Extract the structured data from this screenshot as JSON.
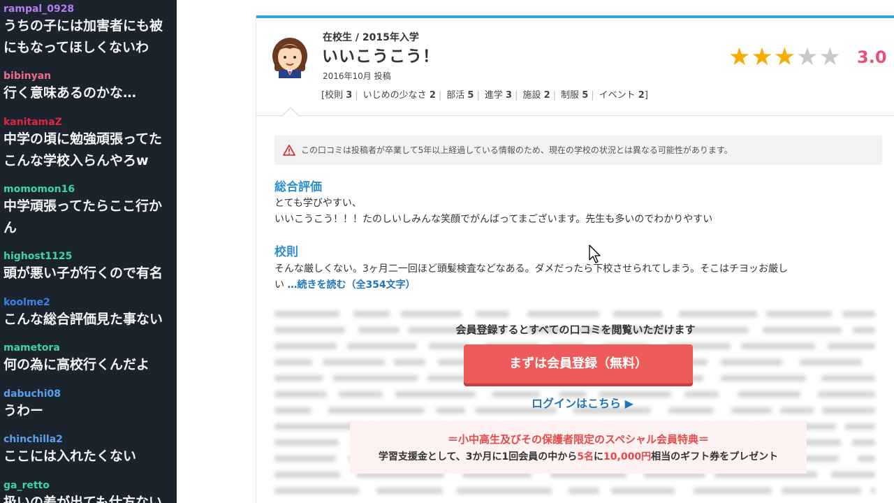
{
  "chat": {
    "messages": [
      {
        "user": "rampal_0928",
        "color": "#b77cf2",
        "lines": [
          "うちの子には加害者にも被",
          "にもなってほしくないわ"
        ]
      },
      {
        "user": "bibinyan",
        "color": "#f06a8f",
        "lines": [
          "行く意味あるのかな…"
        ]
      },
      {
        "user": "kanitamaZ",
        "color": "#e2234a",
        "lines": [
          "中学の頃に勉強頑張ってた",
          "こんな学校入らんやろw"
        ]
      },
      {
        "user": "momomon16",
        "color": "#3bd6a6",
        "lines": [
          "中学頑張ってたらここ行か",
          "ん"
        ]
      },
      {
        "user": "highost1125",
        "color": "#3bd6a6",
        "lines": [
          "頭が悪い子が行くので有名"
        ]
      },
      {
        "user": "koolme2",
        "color": "#3b82e8",
        "lines": [
          "こんな総合評価見た事ない"
        ]
      },
      {
        "user": "mametora",
        "color": "#3bd6a6",
        "lines": [
          "何の為に高校行くんだよ"
        ]
      },
      {
        "user": "dabuchi08",
        "color": "#5aa0ea",
        "lines": [
          "うわー"
        ]
      },
      {
        "user": "chinchilla2",
        "color": "#5aa0ea",
        "lines": [
          "ここには入れたくない"
        ]
      },
      {
        "user": "ga_retto",
        "color": "#3bd6a6",
        "lines": [
          "扱いの差が出ても仕方ない"
        ]
      }
    ]
  },
  "review": {
    "role": "在校生 / 2015年入学",
    "title": "いいこうこう！",
    "posted": "2016年10月 投稿",
    "cats_open": "[",
    "cats_close": "]",
    "categories": [
      {
        "label": "校則",
        "score": "3"
      },
      {
        "label": "いじめの少なさ",
        "score": "2"
      },
      {
        "label": "部活",
        "score": "5"
      },
      {
        "label": "進学",
        "score": "3"
      },
      {
        "label": "施設",
        "score": "2"
      },
      {
        "label": "制服",
        "score": "5"
      },
      {
        "label": "イベント",
        "score": "2"
      }
    ],
    "rating": 3,
    "rating_max": 5,
    "score": "3.0",
    "warning": "この口コミは投稿者が卒業して5年以上経過している情報のため、現在の学校の状況とは異なる可能性があります。",
    "sections": [
      {
        "heading": "総合評価",
        "lines": [
          "とても学びやすい、",
          "いいこうこう！！！たのしいしみんな笑顔でがんばってまございます。先生も多いのでわかりやすい"
        ]
      },
      {
        "heading": "校則",
        "lines": [
          "そんな厳しくない。3ヶ月二一回ほど頭髪検査などなある。ダメだったら下校させられてしまう。そこはチヨッお厳し",
          "い"
        ]
      }
    ],
    "read_more": "…続きを読む（全354文字）"
  },
  "cta": {
    "message": "会員登録するとすべての口コミを閲覧いただけます",
    "register_label": "まずは会員登録（無料）",
    "login_label": "ログインはこちら ▶",
    "promo_heading": "＝小中高生及びその保護者限定のスペシャル会員特典＝",
    "promo_part1": "学習支援金として、3か月に1回会員の中から",
    "promo_count": "5名",
    "promo_part2": "に",
    "promo_amount": "10,000円",
    "promo_part3": "相当のギフト券をプレゼント"
  },
  "colors": {
    "accent": "#2ea7e0",
    "star": "#f6ab00",
    "score": "#e8527a",
    "button": "#ee5a59",
    "link": "#2076b8"
  }
}
